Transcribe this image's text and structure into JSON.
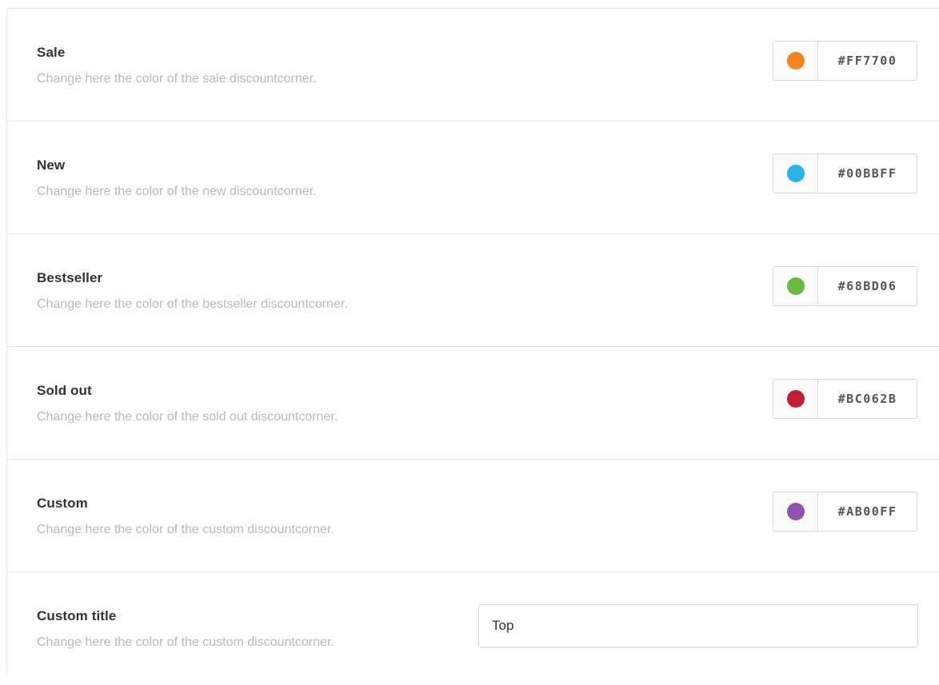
{
  "settings": {
    "rows": [
      {
        "label": "Sale",
        "description": "Change here the color of the sale discountcorner.",
        "hex": "#FF7700",
        "swatch_color": "#F5851F"
      },
      {
        "label": "New",
        "description": "Change here the color of the new discountcorner.",
        "hex": "#00BBFF",
        "swatch_color": "#2AB3E8"
      },
      {
        "label": "Bestseller",
        "description": "Change here the color of the bestseller discountcorner.",
        "hex": "#68BD06",
        "swatch_color": "#69BB3E"
      },
      {
        "label": "Sold out",
        "description": "Change here the color of the sold out discountcorner.",
        "hex": "#BC062B",
        "swatch_color": "#C31F34"
      },
      {
        "label": "Custom",
        "description": "Change here the color of the custom discountcorner.",
        "hex": "#AB00FF",
        "swatch_color": "#8F52AE"
      }
    ],
    "custom_title": {
      "label": "Custom title",
      "description": "Change here the color of the custom discountcorner.",
      "value": "Top"
    }
  }
}
